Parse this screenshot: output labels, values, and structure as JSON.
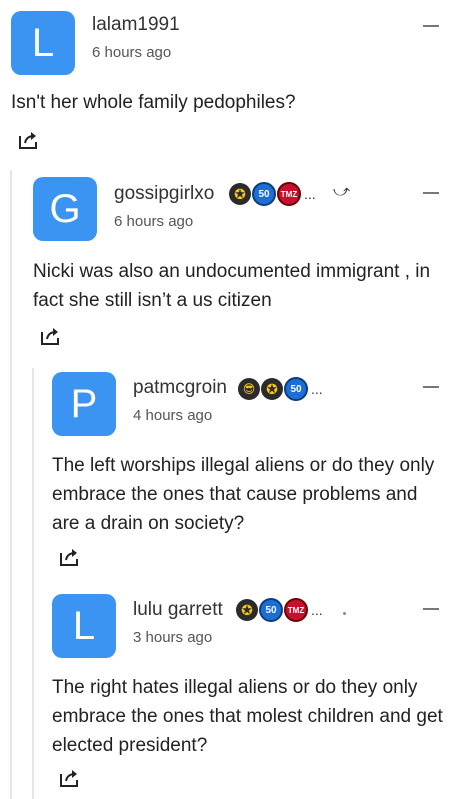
{
  "comments": [
    {
      "avatar_letter": "L",
      "username": "lalam1991",
      "time": "6 hours ago",
      "text": "Isn't her whole family pedophiles?"
    },
    {
      "avatar_letter": "G",
      "username": "gossipgirlxo",
      "time": "6 hours ago",
      "text": "Nicki was also an undocumented immigrant , in fact she still isn’t a us citizen",
      "badges": [
        "star-badge",
        "50-badge",
        "tmz-badge"
      ]
    },
    {
      "avatar_letter": "P",
      "username": "patmcgroin",
      "time": "4 hours ago",
      "text": "The left worships illegal aliens or do they only embrace the ones that cause problems and are a drain on society?",
      "badges": [
        "sunglasses-badge",
        "star-badge",
        "50-badge"
      ]
    },
    {
      "avatar_letter": "L",
      "username": "lulu garrett",
      "time": "3 hours ago",
      "text": "The right hates illegal aliens or do they only embrace the ones that molest children and get elected president?",
      "badges": [
        "star-badge",
        "50-badge",
        "tmz-badge"
      ]
    }
  ],
  "badge_text": {
    "fifty": "50",
    "tmz": "TMZ",
    "more": "..."
  },
  "colors": {
    "avatar": "#3b93f2",
    "thread_line": "#e6e6e6"
  }
}
